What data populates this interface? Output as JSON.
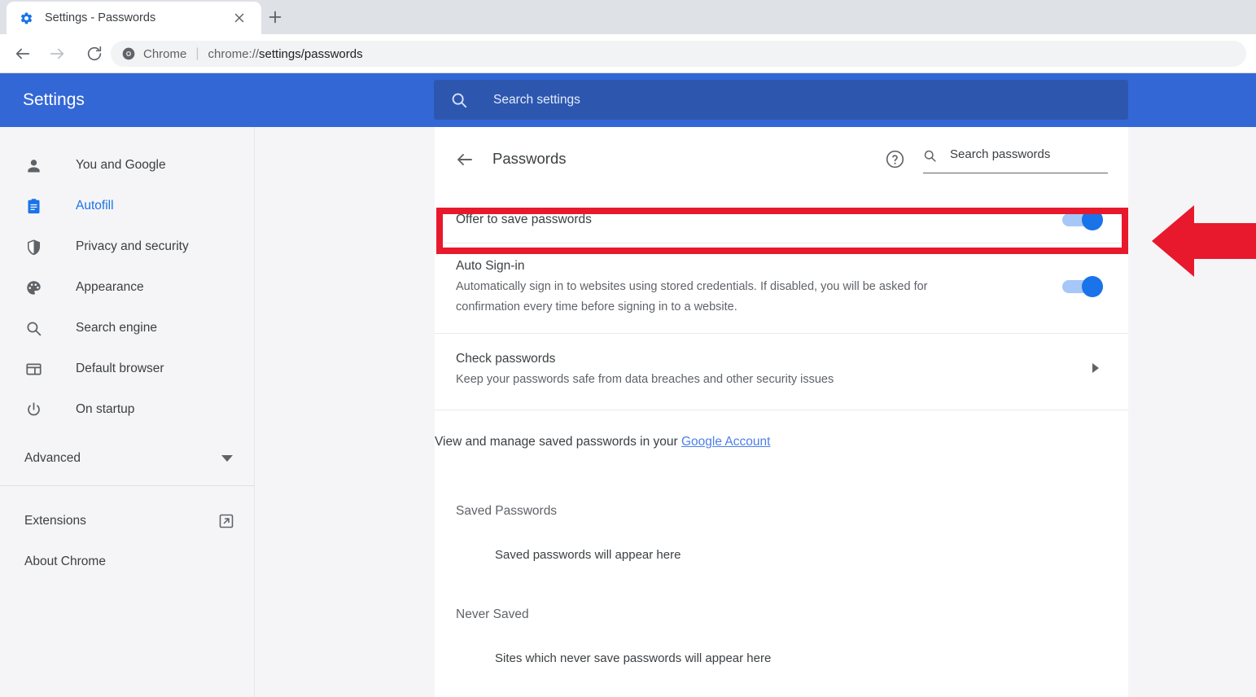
{
  "browser": {
    "tab": {
      "title": "Settings - Passwords",
      "favicon_icon": "gear-icon",
      "close_icon": "close-icon"
    },
    "new_tab_icon": "plus-icon",
    "nav": {
      "back_icon": "arrow-left-icon",
      "forward_icon": "arrow-right-icon",
      "reload_icon": "reload-icon"
    },
    "omnibox": {
      "site_icon": "chrome-icon",
      "chip_label": "Chrome",
      "separator": "|",
      "url_prefix": "chrome://",
      "url_emphasis": "settings/passwords"
    }
  },
  "settings": {
    "brand": "Settings",
    "search": {
      "icon": "search-icon",
      "placeholder": "Search settings",
      "value": ""
    },
    "sidebar": {
      "items": [
        {
          "label": "You and Google",
          "icon": "person-icon",
          "active": false
        },
        {
          "label": "Autofill",
          "icon": "clipboard-icon",
          "active": true
        },
        {
          "label": "Privacy and security",
          "icon": "shield-icon",
          "active": false
        },
        {
          "label": "Appearance",
          "icon": "palette-icon",
          "active": false
        },
        {
          "label": "Search engine",
          "icon": "search-icon",
          "active": false
        },
        {
          "label": "Default browser",
          "icon": "browser-window-icon",
          "active": false
        },
        {
          "label": "On startup",
          "icon": "power-icon",
          "active": false
        }
      ],
      "advanced": {
        "label": "Advanced",
        "icon": "chevron-down-icon"
      },
      "extensions": {
        "label": "Extensions",
        "icon": "external-link-icon"
      },
      "about": {
        "label": "About Chrome"
      }
    },
    "passwords_page": {
      "back_icon": "arrow-left-icon",
      "title": "Passwords",
      "help_icon": "help-circle-icon",
      "search": {
        "icon": "search-icon",
        "placeholder": "Search passwords",
        "value": ""
      },
      "offer_to_save": {
        "label": "Offer to save passwords",
        "toggle_state": "on"
      },
      "auto_signin": {
        "label": "Auto Sign-in",
        "description": "Automatically sign in to websites using stored credentials. If disabled, you will be asked for confirmation every time before signing in to a website.",
        "toggle_state": "on"
      },
      "check_passwords": {
        "label": "Check passwords",
        "description": "Keep your passwords safe from data breaches and other security issues",
        "chevron_icon": "chevron-right-icon"
      },
      "manage": {
        "text": "View and manage saved passwords in your ",
        "link_label": "Google Account"
      },
      "saved_passwords": {
        "title": "Saved Passwords",
        "empty_text": "Saved passwords will appear here"
      },
      "never_saved": {
        "title": "Never Saved",
        "empty_text": "Sites which never save passwords will appear here"
      }
    }
  },
  "annotations": {
    "highlight_target": "offer-to-save-passwords-row",
    "arrow_icon": "left-arrow-annotation",
    "accent_color": "#e8192c"
  }
}
